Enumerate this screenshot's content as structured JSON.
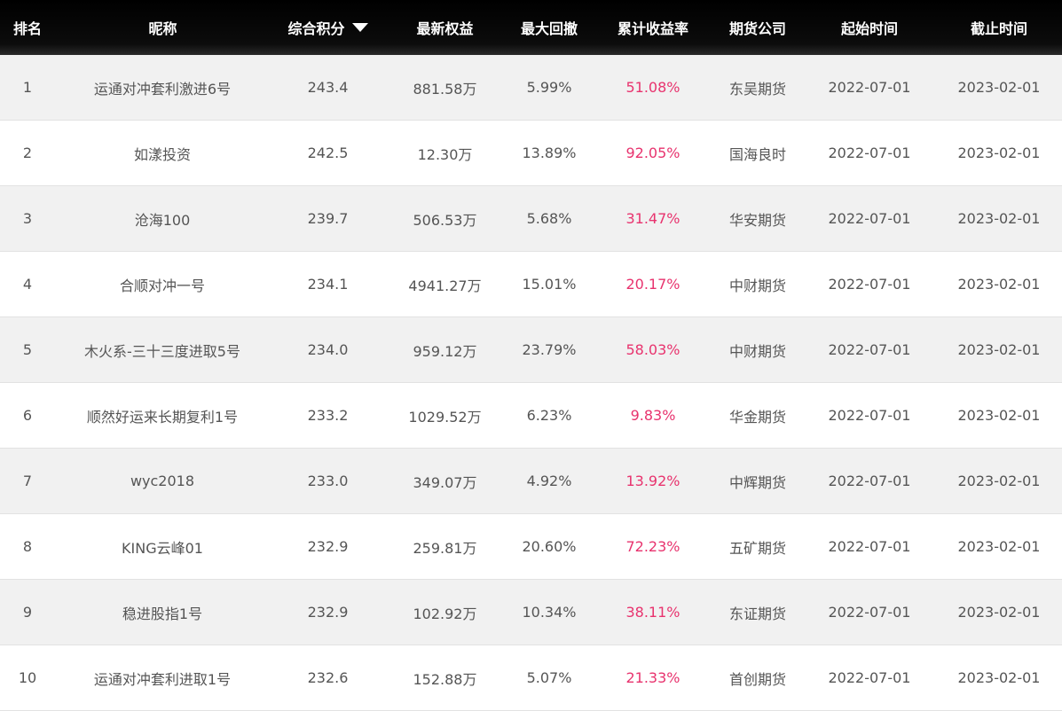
{
  "header": {
    "rank": "排名",
    "nickname": "昵称",
    "score": "综合积分",
    "equity": "最新权益",
    "drawdown": "最大回撤",
    "return": "累计收益率",
    "company": "期货公司",
    "start": "起始时间",
    "end": "截止时间",
    "sort_icon": "caret-down-icon"
  },
  "colors": {
    "header_bg": "#000000",
    "return_text": "#e8336e",
    "odd_row": "#f1f1f1"
  },
  "rows": [
    {
      "rank": "1",
      "name": "运通对冲套利激进6号",
      "score": "243.4",
      "equity": "881.58万",
      "drawdown": "5.99%",
      "return": "51.08%",
      "company": "东吴期货",
      "start": "2022-07-01",
      "end": "2023-02-01"
    },
    {
      "rank": "2",
      "name": "如漾投资",
      "score": "242.5",
      "equity": "12.30万",
      "drawdown": "13.89%",
      "return": "92.05%",
      "company": "国海良时",
      "start": "2022-07-01",
      "end": "2023-02-01"
    },
    {
      "rank": "3",
      "name": "沧海100",
      "score": "239.7",
      "equity": "506.53万",
      "drawdown": "5.68%",
      "return": "31.47%",
      "company": "华安期货",
      "start": "2022-07-01",
      "end": "2023-02-01"
    },
    {
      "rank": "4",
      "name": "合顺对冲一号",
      "score": "234.1",
      "equity": "4941.27万",
      "drawdown": "15.01%",
      "return": "20.17%",
      "company": "中财期货",
      "start": "2022-07-01",
      "end": "2023-02-01"
    },
    {
      "rank": "5",
      "name": "木火系-三十三度进取5号",
      "score": "234.0",
      "equity": "959.12万",
      "drawdown": "23.79%",
      "return": "58.03%",
      "company": "中财期货",
      "start": "2022-07-01",
      "end": "2023-02-01"
    },
    {
      "rank": "6",
      "name": "顺然好运来长期复利1号",
      "score": "233.2",
      "equity": "1029.52万",
      "drawdown": "6.23%",
      "return": "9.83%",
      "company": "华金期货",
      "start": "2022-07-01",
      "end": "2023-02-01"
    },
    {
      "rank": "7",
      "name": "wyc2018",
      "score": "233.0",
      "equity": "349.07万",
      "drawdown": "4.92%",
      "return": "13.92%",
      "company": "中辉期货",
      "start": "2022-07-01",
      "end": "2023-02-01"
    },
    {
      "rank": "8",
      "name": "KING云峰01",
      "score": "232.9",
      "equity": "259.81万",
      "drawdown": "20.60%",
      "return": "72.23%",
      "company": "五矿期货",
      "start": "2022-07-01",
      "end": "2023-02-01"
    },
    {
      "rank": "9",
      "name": "稳进股指1号",
      "score": "232.9",
      "equity": "102.92万",
      "drawdown": "10.34%",
      "return": "38.11%",
      "company": "东证期货",
      "start": "2022-07-01",
      "end": "2023-02-01"
    },
    {
      "rank": "10",
      "name": "运通对冲套利进取1号",
      "score": "232.6",
      "equity": "152.88万",
      "drawdown": "5.07%",
      "return": "21.33%",
      "company": "首创期货",
      "start": "2022-07-01",
      "end": "2023-02-01"
    }
  ]
}
